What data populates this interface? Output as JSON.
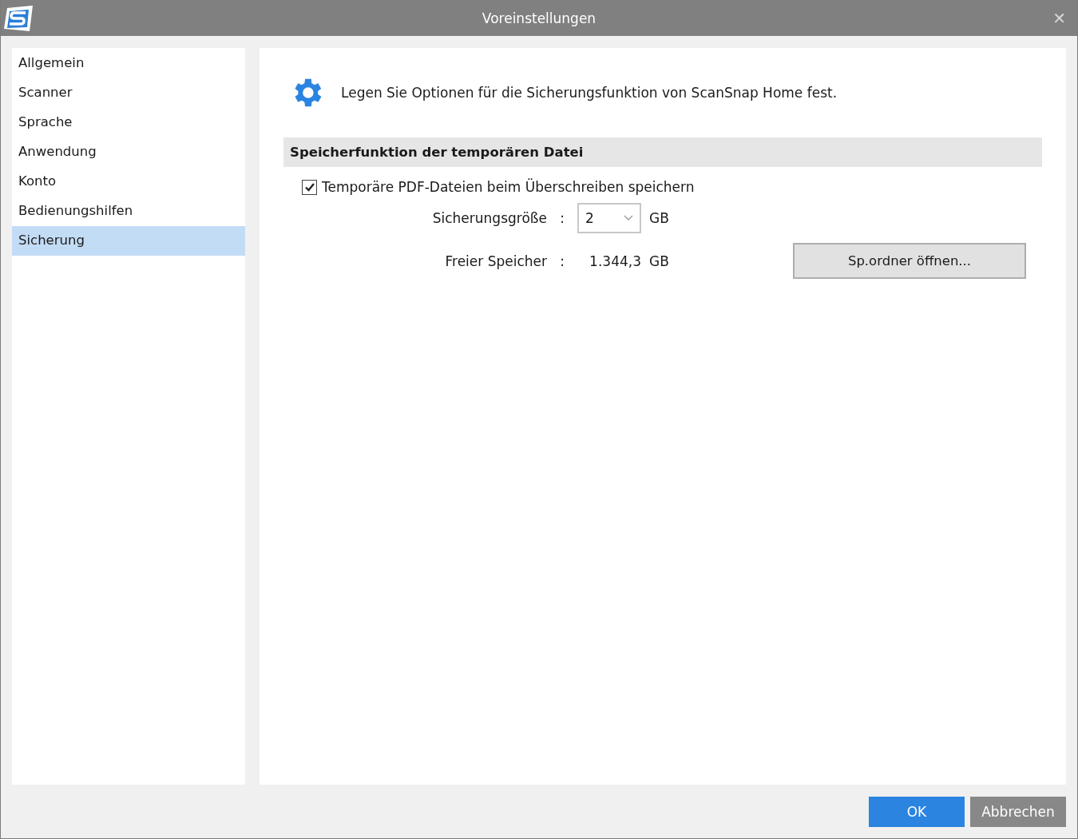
{
  "window": {
    "title": "Voreinstellungen",
    "close": "✕"
  },
  "sidebar": {
    "items": [
      {
        "label": "Allgemein",
        "selected": false
      },
      {
        "label": "Scanner",
        "selected": false
      },
      {
        "label": "Sprache",
        "selected": false
      },
      {
        "label": "Anwendung",
        "selected": false
      },
      {
        "label": "Konto",
        "selected": false
      },
      {
        "label": "Bedienungshilfen",
        "selected": false
      },
      {
        "label": "Sicherung",
        "selected": true
      }
    ]
  },
  "intro": "Legen Sie Optionen für die Sicherungsfunktion von ScanSnap Home fest.",
  "section": {
    "title": "Speicherfunktion der temporären Datei",
    "checkbox": {
      "label": "Temporäre PDF-Dateien beim Überschreiben speichern",
      "checked": true
    },
    "backup_size": {
      "label": "Sicherungsgröße",
      "colon": ":",
      "value": "2",
      "unit": "GB"
    },
    "free_space": {
      "label": "Freier Speicher",
      "colon": ":",
      "value": "1.344,3",
      "unit": "GB"
    },
    "open_folder_button": "Sp.ordner öffnen..."
  },
  "buttons": [
    {
      "label": "OK",
      "kind": "primary"
    },
    {
      "label": "Abbrechen",
      "kind": "secondary"
    }
  ]
}
